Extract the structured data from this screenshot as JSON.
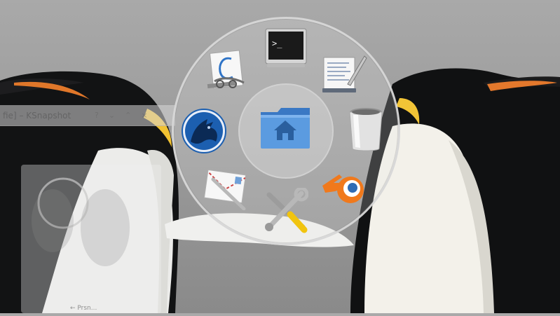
{
  "background_window": {
    "title": "fie] – KSnapshot",
    "footer_text": "← Prsn..."
  },
  "launcher": {
    "center_item": {
      "label": "Home Folder",
      "icon": "home-folder-icon"
    },
    "items": [
      {
        "label": "Terminal",
        "icon": "terminal-icon"
      },
      {
        "label": "Text Editor",
        "icon": "text-editor-icon"
      },
      {
        "label": "Trash",
        "icon": "trash-icon"
      },
      {
        "label": "Blender",
        "icon": "blender-icon"
      },
      {
        "label": "System Settings",
        "icon": "settings-tools-icon"
      },
      {
        "label": "Mail",
        "icon": "mail-icon"
      },
      {
        "label": "Amarok",
        "icon": "amarok-icon"
      },
      {
        "label": "Calligra Words",
        "icon": "word-processor-icon"
      }
    ]
  },
  "colors": {
    "folder_blue": "#4f8fd6",
    "amarok_blue": "#1c5fb0",
    "blender_orange": "#f0791c",
    "ring": "#d8d8d8"
  }
}
